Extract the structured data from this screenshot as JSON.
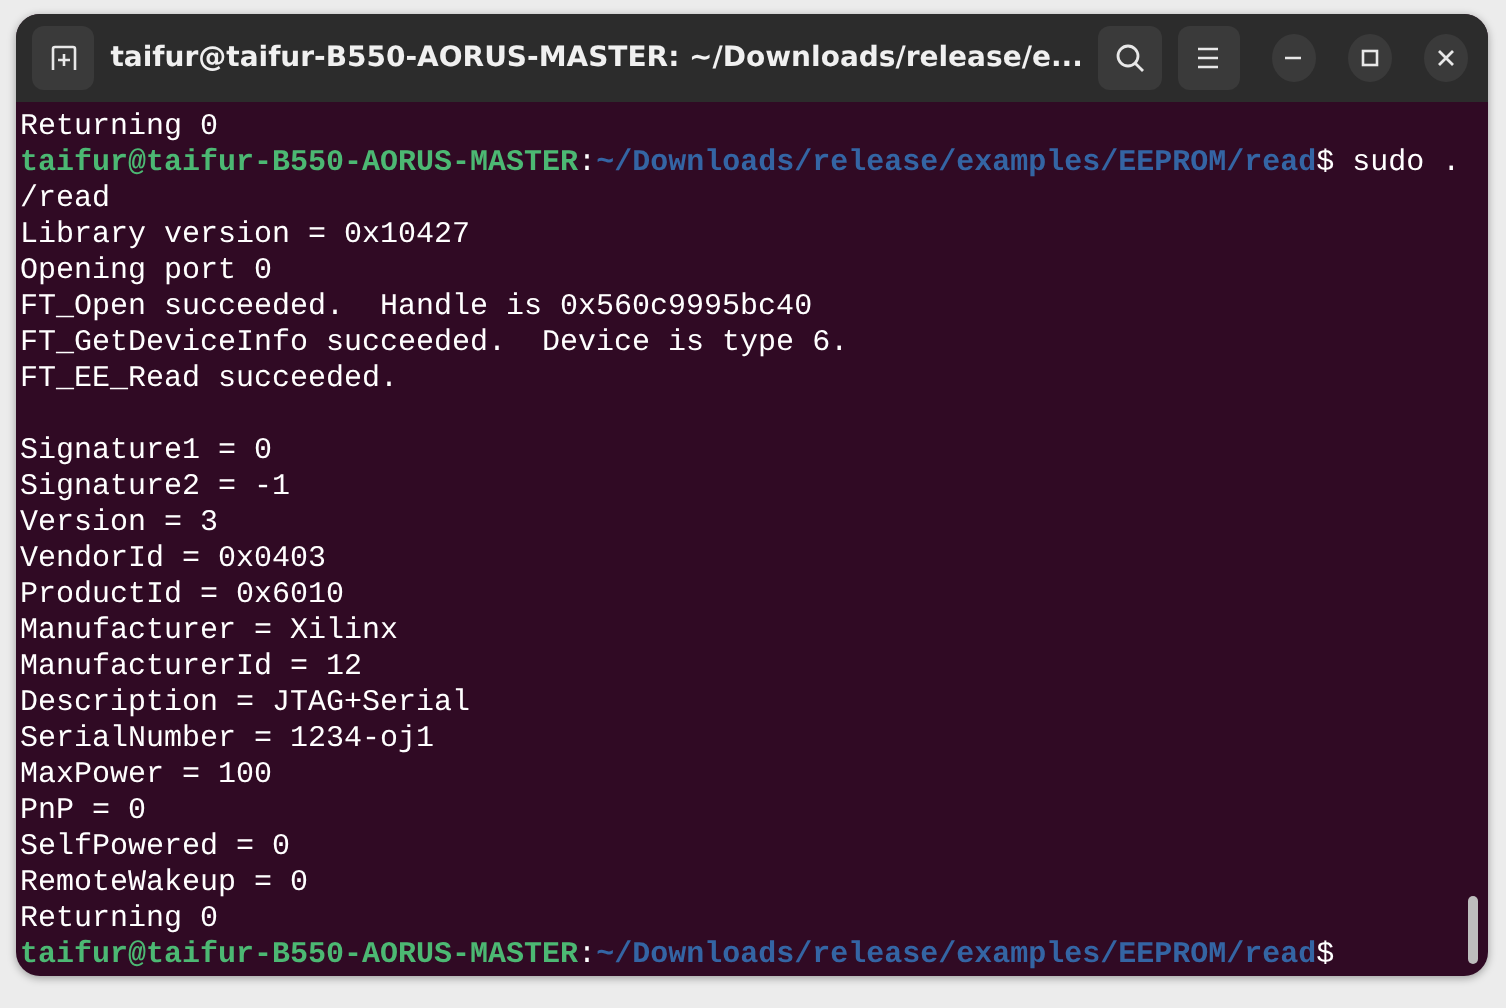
{
  "window": {
    "title": "taifur@taifur-B550-AORUS-MASTER: ~/Downloads/release/e..."
  },
  "terminal": {
    "lines": [
      {
        "kind": "output",
        "text": "Returning 0"
      },
      {
        "kind": "prompt",
        "user": "taifur@taifur-B550-AORUS-MASTER",
        "separator": ":",
        "path": "~/Downloads/release/examples/EEPROM/read",
        "symbol": "$",
        "command": " sudo ."
      },
      {
        "kind": "output",
        "text": "/read"
      },
      {
        "kind": "output",
        "text": "Library version = 0x10427"
      },
      {
        "kind": "output",
        "text": "Opening port 0"
      },
      {
        "kind": "output",
        "text": "FT_Open succeeded.  Handle is 0x560c9995bc40"
      },
      {
        "kind": "output",
        "text": "FT_GetDeviceInfo succeeded.  Device is type 6."
      },
      {
        "kind": "output",
        "text": "FT_EE_Read succeeded."
      },
      {
        "kind": "blank"
      },
      {
        "kind": "output",
        "text": "Signature1 = 0"
      },
      {
        "kind": "output",
        "text": "Signature2 = -1"
      },
      {
        "kind": "output",
        "text": "Version = 3"
      },
      {
        "kind": "output",
        "text": "VendorId = 0x0403"
      },
      {
        "kind": "output",
        "text": "ProductId = 0x6010"
      },
      {
        "kind": "output",
        "text": "Manufacturer = Xilinx"
      },
      {
        "kind": "output",
        "text": "ManufacturerId = 12"
      },
      {
        "kind": "output",
        "text": "Description = JTAG+Serial"
      },
      {
        "kind": "output",
        "text": "SerialNumber = 1234-oj1"
      },
      {
        "kind": "output",
        "text": "MaxPower = 100"
      },
      {
        "kind": "output",
        "text": "PnP = 0"
      },
      {
        "kind": "output",
        "text": "SelfPowered = 0"
      },
      {
        "kind": "output",
        "text": "RemoteWakeup = 0"
      },
      {
        "kind": "output",
        "text": "Returning 0"
      },
      {
        "kind": "prompt",
        "user": "taifur@taifur-B550-AORUS-MASTER",
        "separator": ":",
        "path": "~/Downloads/release/examples/EEPROM/read",
        "symbol": "$"
      }
    ]
  }
}
